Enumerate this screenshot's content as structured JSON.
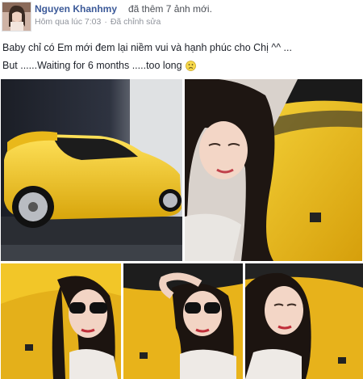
{
  "post": {
    "author": "Nguyen Khanhmy",
    "action": "đã thêm 7 ảnh mới.",
    "time": "Hôm qua lúc 7:03",
    "separator": "·",
    "privacy": "Đã chỉnh sửa",
    "caption_line1": "Baby chỉ có Em mới đem lại niềm vui và hạnh phúc cho Chị ^^ ...",
    "caption_line2": "But ......Waiting for 6 months .....too long",
    "emoji": "frown-emoticon",
    "photos": [
      {
        "name": "yellow-lamborghini-garage-photo"
      },
      {
        "name": "selfie-with-car-hood-photo"
      },
      {
        "name": "sunglasses-selfie-photo-1"
      },
      {
        "name": "sunglasses-selfie-photo-2"
      },
      {
        "name": "selfie-car-hood-photo-3"
      }
    ]
  },
  "colors": {
    "link": "#3b5998",
    "meta": "#90949c",
    "text": "#1d2129",
    "car_yellow": "#f2c21a"
  }
}
